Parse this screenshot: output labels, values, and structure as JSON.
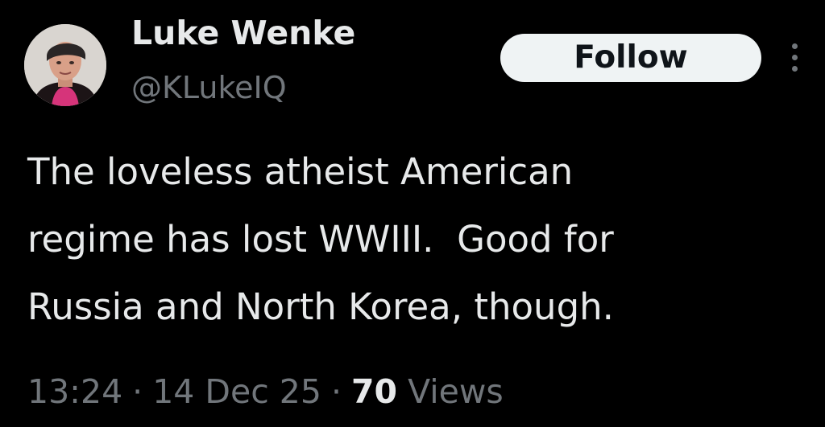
{
  "author": {
    "display_name": "Luke Wenke",
    "handle": "@KLukeIQ",
    "avatar_icon": "profile-photo"
  },
  "actions": {
    "follow_label": "Follow",
    "more_icon": "more-vertical-icon"
  },
  "tweet": {
    "text_lines": [
      "The loveless atheist American",
      "regime has lost WWIII.  Good for",
      "Russia and North Korea, though."
    ]
  },
  "meta": {
    "time": "13:24",
    "date": "14 Dec 25",
    "separator": "·",
    "views_count": "70",
    "views_label": "Views"
  },
  "colors": {
    "background": "#000000",
    "primary_text": "#e7e9ea",
    "secondary_text": "#71767b",
    "button_bg": "#eff3f4",
    "button_text": "#0f1419"
  }
}
